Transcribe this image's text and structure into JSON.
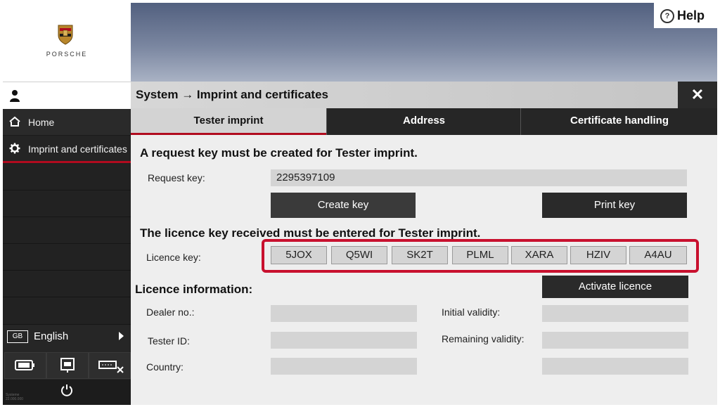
{
  "brand": {
    "name": "PORSCHE"
  },
  "header": {
    "help_label": "Help",
    "breadcrumb": "System → Imprint and certificates",
    "close_label": "✕"
  },
  "sidebar": {
    "items": [
      {
        "label": "Home",
        "icon": "home-icon"
      },
      {
        "label": "Imprint and certificates",
        "icon": "gear-icon"
      }
    ],
    "language": {
      "code": "GB",
      "label": "English"
    },
    "tools": [
      "battery-icon",
      "network-icon",
      "disconnect-icon"
    ],
    "system_text": [
      "Systeme",
      "22.000.000"
    ]
  },
  "tabs": [
    {
      "label": "Tester imprint",
      "active": true
    },
    {
      "label": "Address",
      "active": false
    },
    {
      "label": "Certificate handling",
      "active": false
    }
  ],
  "request": {
    "heading": "A request key must be created for Tester imprint.",
    "label": "Request key:",
    "value": "2295397109",
    "create_button": "Create key",
    "print_button": "Print key"
  },
  "licence": {
    "heading": "The licence key received must be entered for Tester imprint.",
    "label": "Licence key:",
    "segments": [
      "5JOX",
      "Q5WI",
      "SK2T",
      "PLML",
      "XARA",
      "HZIV",
      "A4AU"
    ],
    "activate_button": "Activate licence"
  },
  "info": {
    "heading": "Licence information:",
    "dealer_label": "Dealer no.:",
    "dealer_value": "",
    "tester_label": "Tester ID:",
    "tester_value": "",
    "country_label": "Country:",
    "country_value": "",
    "initial_label": "Initial validity:",
    "initial_value": "",
    "remaining_label": "Remaining validity:",
    "remaining_value": "",
    "extra_value": ""
  },
  "colors": {
    "accent": "#b10b1f",
    "highlight": "#c8102e",
    "dark": "#262626"
  }
}
